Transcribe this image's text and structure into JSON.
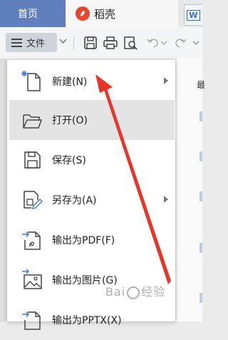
{
  "tabs": {
    "home_label": "首页",
    "daoke_label": "稻壳",
    "doc_label": "W"
  },
  "toolbar": {
    "file_label": "文件"
  },
  "menu": {
    "items": [
      {
        "label": "新建(N)",
        "icon": "new-document-icon",
        "has_submenu": true
      },
      {
        "label": "打开(O)",
        "icon": "folder-open-icon",
        "has_submenu": false
      },
      {
        "label": "保存(S)",
        "icon": "save-icon",
        "has_submenu": false
      },
      {
        "label": "另存为(A)",
        "icon": "save-as-icon",
        "has_submenu": true
      },
      {
        "label": "输出为PDF(F)",
        "icon": "export-pdf-icon",
        "has_submenu": false
      },
      {
        "label": "输出为图片(G)",
        "icon": "export-image-icon",
        "has_submenu": false
      },
      {
        "label": "输出为PPTX(X)",
        "icon": "export-pptx-icon",
        "has_submenu": false
      }
    ]
  },
  "right_panel": {
    "text": "最"
  },
  "watermark": {
    "text_left": "Bai",
    "text_right": "经验"
  },
  "colors": {
    "home_tab": "#5f7fbd",
    "daoke_logo": "#e8472e",
    "active_item": "#e4e4e4",
    "annotation_arrow": "#e8352a"
  }
}
